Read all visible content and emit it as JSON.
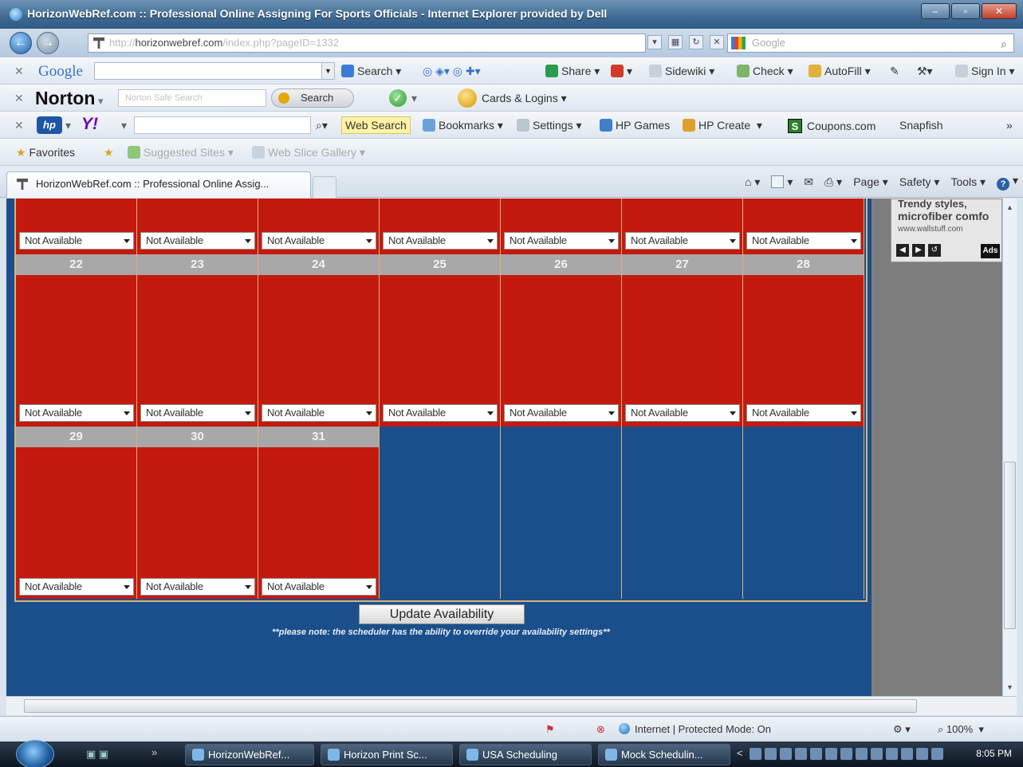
{
  "window": {
    "title": "HorizonWebRef.com :: Professional Online Assigning For Sports Officials - Internet Explorer provided by Dell",
    "min_label": "–",
    "max_label": "▫",
    "close_label": "✕"
  },
  "address": {
    "url_prefix": "http://",
    "url_domain": "horizonwebref.com",
    "url_path": "/index.php?pageID=1332",
    "search_placeholder": "Google"
  },
  "toolbar_google": {
    "logo": "Google",
    "items": [
      "Search",
      "Share",
      "Sidewiki",
      "Check",
      "AutoFill",
      "Sign In"
    ]
  },
  "toolbar_norton": {
    "logo": "Norton",
    "search_placeholder": "Norton Safe Search",
    "search_label": "Search",
    "cards_label": "Cards & Logins"
  },
  "toolbar_hp": {
    "hp_logo": "hp",
    "yahoo_logo": "Y!",
    "web_search": "Web Search",
    "bookmarks": "Bookmarks",
    "settings": "Settings",
    "hp_games": "HP Games",
    "hp_create": "HP Create",
    "coupons_icon": "S",
    "coupons": "Coupons.com",
    "snapfish": "Snapfish",
    "more": "»"
  },
  "favorites_bar": {
    "favorites": "Favorites",
    "suggested_sites": "Suggested Sites",
    "web_slice": "Web Slice Gallery"
  },
  "tab": {
    "title": "HorizonWebRef.com :: Professional Online Assig..."
  },
  "command_bar": {
    "page": "Page",
    "safety": "Safety",
    "tools": "Tools",
    "help": "?"
  },
  "calendar": {
    "row1_selects": [
      "Not Available",
      "Not Available",
      "Not Available",
      "Not Available",
      "Not Available",
      "Not Available",
      "Not Available"
    ],
    "week2_days": [
      "22",
      "23",
      "24",
      "25",
      "26",
      "27",
      "28"
    ],
    "week2_selects": [
      "Not Available",
      "Not Available",
      "Not Available",
      "Not Available",
      "Not Available",
      "Not Available",
      "Not Available"
    ],
    "week3_days": [
      "29",
      "30",
      "31"
    ],
    "week3_selects": [
      "Not Available",
      "Not Available",
      "Not Available"
    ],
    "unavailable_color": "#c41a0e",
    "empty_color": "#1a4f8b",
    "header_color": "#a8a8a8"
  },
  "update_button": "Update Availability",
  "note": "**please note: the scheduler has the ability to override your availability settings**",
  "ad": {
    "line1": "Trendy styles,",
    "line2": "microfiber comfo",
    "line3": "www.wallstuff.com",
    "tag": "Ads"
  },
  "status": {
    "zone": "Internet | Protected Mode: On",
    "zoom": "100%"
  },
  "taskbar": {
    "buttons": [
      "HorizonWebRef...",
      "Horizon Print Sc...",
      "USA Scheduling",
      "Mock Schedulin..."
    ],
    "clock": "8:05 PM"
  }
}
